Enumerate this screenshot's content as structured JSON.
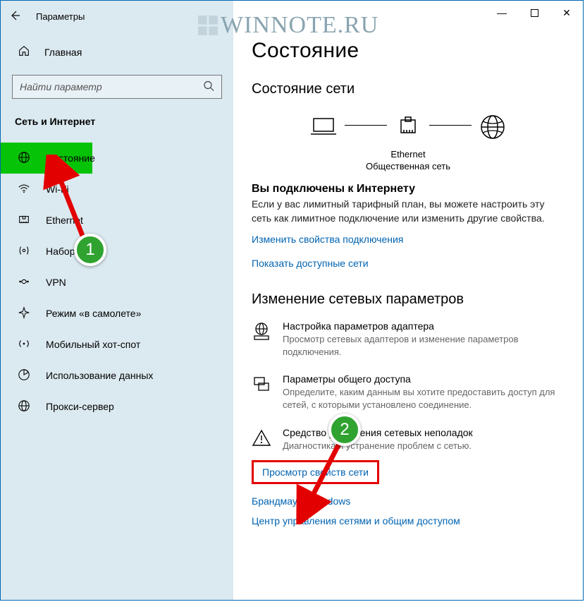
{
  "window": {
    "title": "Параметры"
  },
  "watermark": "WINNOTE.RU",
  "winctrl": {
    "min": "—",
    "max": "☐",
    "close": "✕"
  },
  "home": {
    "label": "Главная"
  },
  "search": {
    "placeholder": "Найти параметр"
  },
  "section": "Сеть и Интернет",
  "nav": [
    {
      "label": "Состояние"
    },
    {
      "label": "Wi-Fi"
    },
    {
      "label": "Ethernet"
    },
    {
      "label": "Набор н..."
    },
    {
      "label": "VPN"
    },
    {
      "label": "Режим «в самолете»"
    },
    {
      "label": "Мобильный хот-спот"
    },
    {
      "label": "Использование данных"
    },
    {
      "label": "Прокси-сервер"
    }
  ],
  "page": {
    "title": "Состояние",
    "status_heading": "Состояние сети",
    "diagram": {
      "center_label": "Ethernet",
      "center_sub": "Общественная сеть"
    },
    "connected_title": "Вы подключены к Интернету",
    "connected_desc": "Если у вас лимитный тарифный план, вы можете настроить эту сеть как лимитное подключение или изменить другие свойства.",
    "link_change": "Изменить свойства подключения",
    "link_show": "Показать доступные сети",
    "change_settings_title": "Изменение сетевых параметров",
    "opt_adapter_title": "Настройка параметров адаптера",
    "opt_adapter_desc": "Просмотр сетевых адаптеров и изменение параметров подключения.",
    "opt_share_title": "Параметры общего доступа",
    "opt_share_desc": "Определите, каким данным вы хотите предоставить доступ для сетей, с которыми установлено соединение.",
    "opt_troubleshoot_title": "Средство устранения сетевых неполадок",
    "opt_troubleshoot_desc": "Диагностика и устранение проблем с сетью.",
    "link_view_props": "Просмотр свойств сети",
    "link_firewall": "Брандмауэр Windows",
    "link_center": "Центр управления сетями и общим доступом"
  },
  "annotations": {
    "one": "1",
    "two": "2"
  }
}
